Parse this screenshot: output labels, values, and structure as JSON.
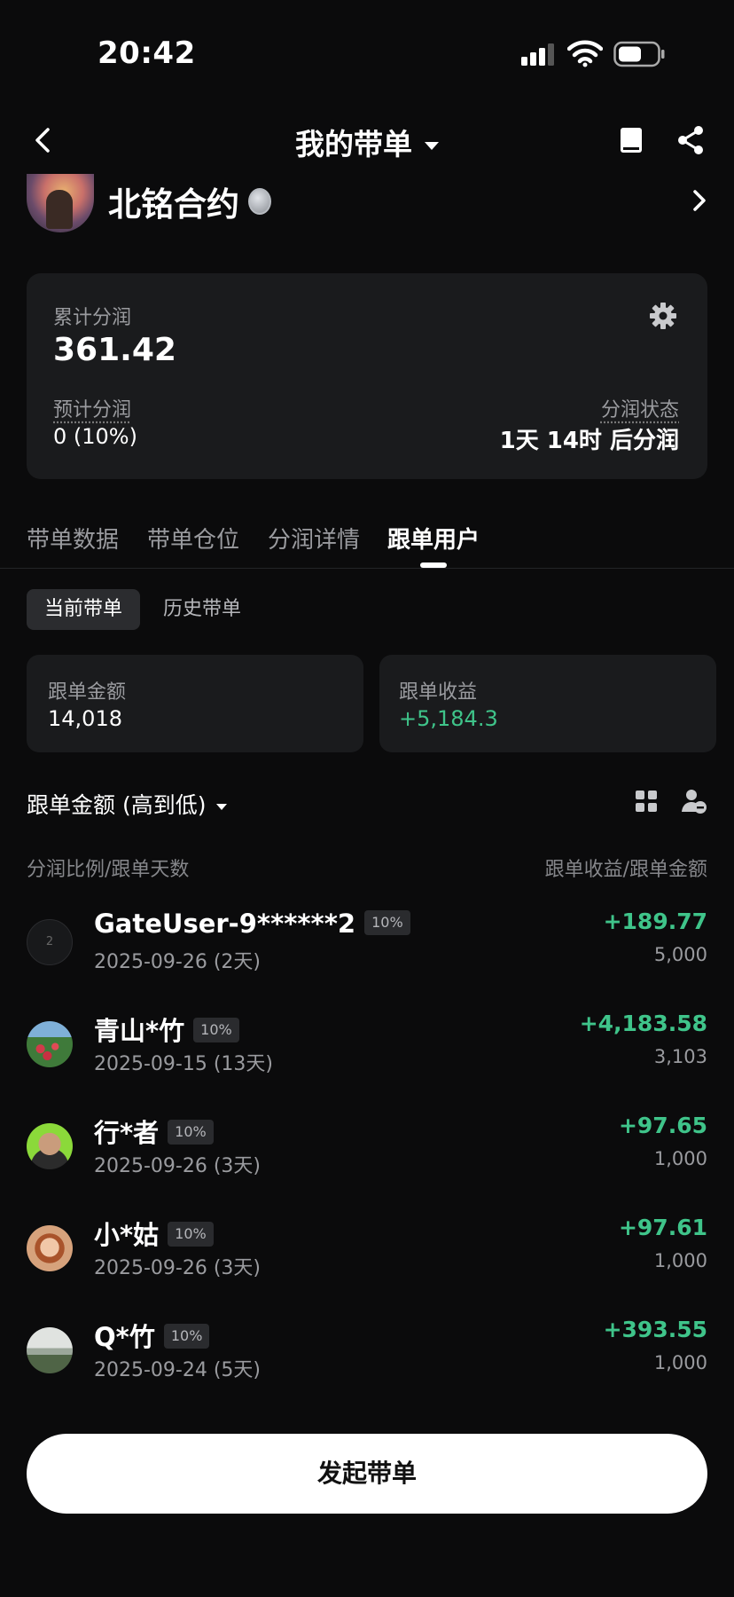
{
  "status_bar": {
    "time": "20:42"
  },
  "header": {
    "title": "我的带单"
  },
  "profile": {
    "name": "北铭合约"
  },
  "summary": {
    "total_label": "累计分润",
    "total_value": "361.42",
    "expected_label": "预计分润",
    "expected_value": "0 (10%)",
    "status_label": "分润状态",
    "status_value": "1天 14时 后分润"
  },
  "tabs": [
    {
      "label": "带单数据"
    },
    {
      "label": "带单仓位"
    },
    {
      "label": "分润详情"
    },
    {
      "label": "跟单用户",
      "active": true
    }
  ],
  "subtabs": {
    "current": "当前带单",
    "history": "历史带单"
  },
  "stats": {
    "amount_label": "跟单金额",
    "amount_value": "14,018",
    "profit_label": "跟单收益",
    "profit_value": "+5,184.3"
  },
  "sort": {
    "label": "跟单金额 (高到低)"
  },
  "columns": {
    "left": "分润比例/跟单天数",
    "right": "跟单收益/跟单金额"
  },
  "followers": [
    {
      "name": "GateUser-9******2",
      "tag": "10%",
      "date": "2025-09-26 (2天)",
      "pnl": "+189.77",
      "amount": "5,000",
      "avatar_text": "2"
    },
    {
      "name": "青山*竹",
      "tag": "10%",
      "date": "2025-09-15 (13天)",
      "pnl": "+4,183.58",
      "amount": "3,103"
    },
    {
      "name": "行*者",
      "tag": "10%",
      "date": "2025-09-26 (3天)",
      "pnl": "+97.65",
      "amount": "1,000"
    },
    {
      "name": "小*姑",
      "tag": "10%",
      "date": "2025-09-26 (3天)",
      "pnl": "+97.61",
      "amount": "1,000"
    },
    {
      "name": "Q*竹",
      "tag": "10%",
      "date": "2025-09-24 (5天)",
      "pnl": "+393.55",
      "amount": "1,000"
    }
  ],
  "cta": {
    "label": "发起带单"
  },
  "colors": {
    "positive": "#3fc48a",
    "background": "#0b0b0c",
    "card": "#1a1b1d"
  }
}
